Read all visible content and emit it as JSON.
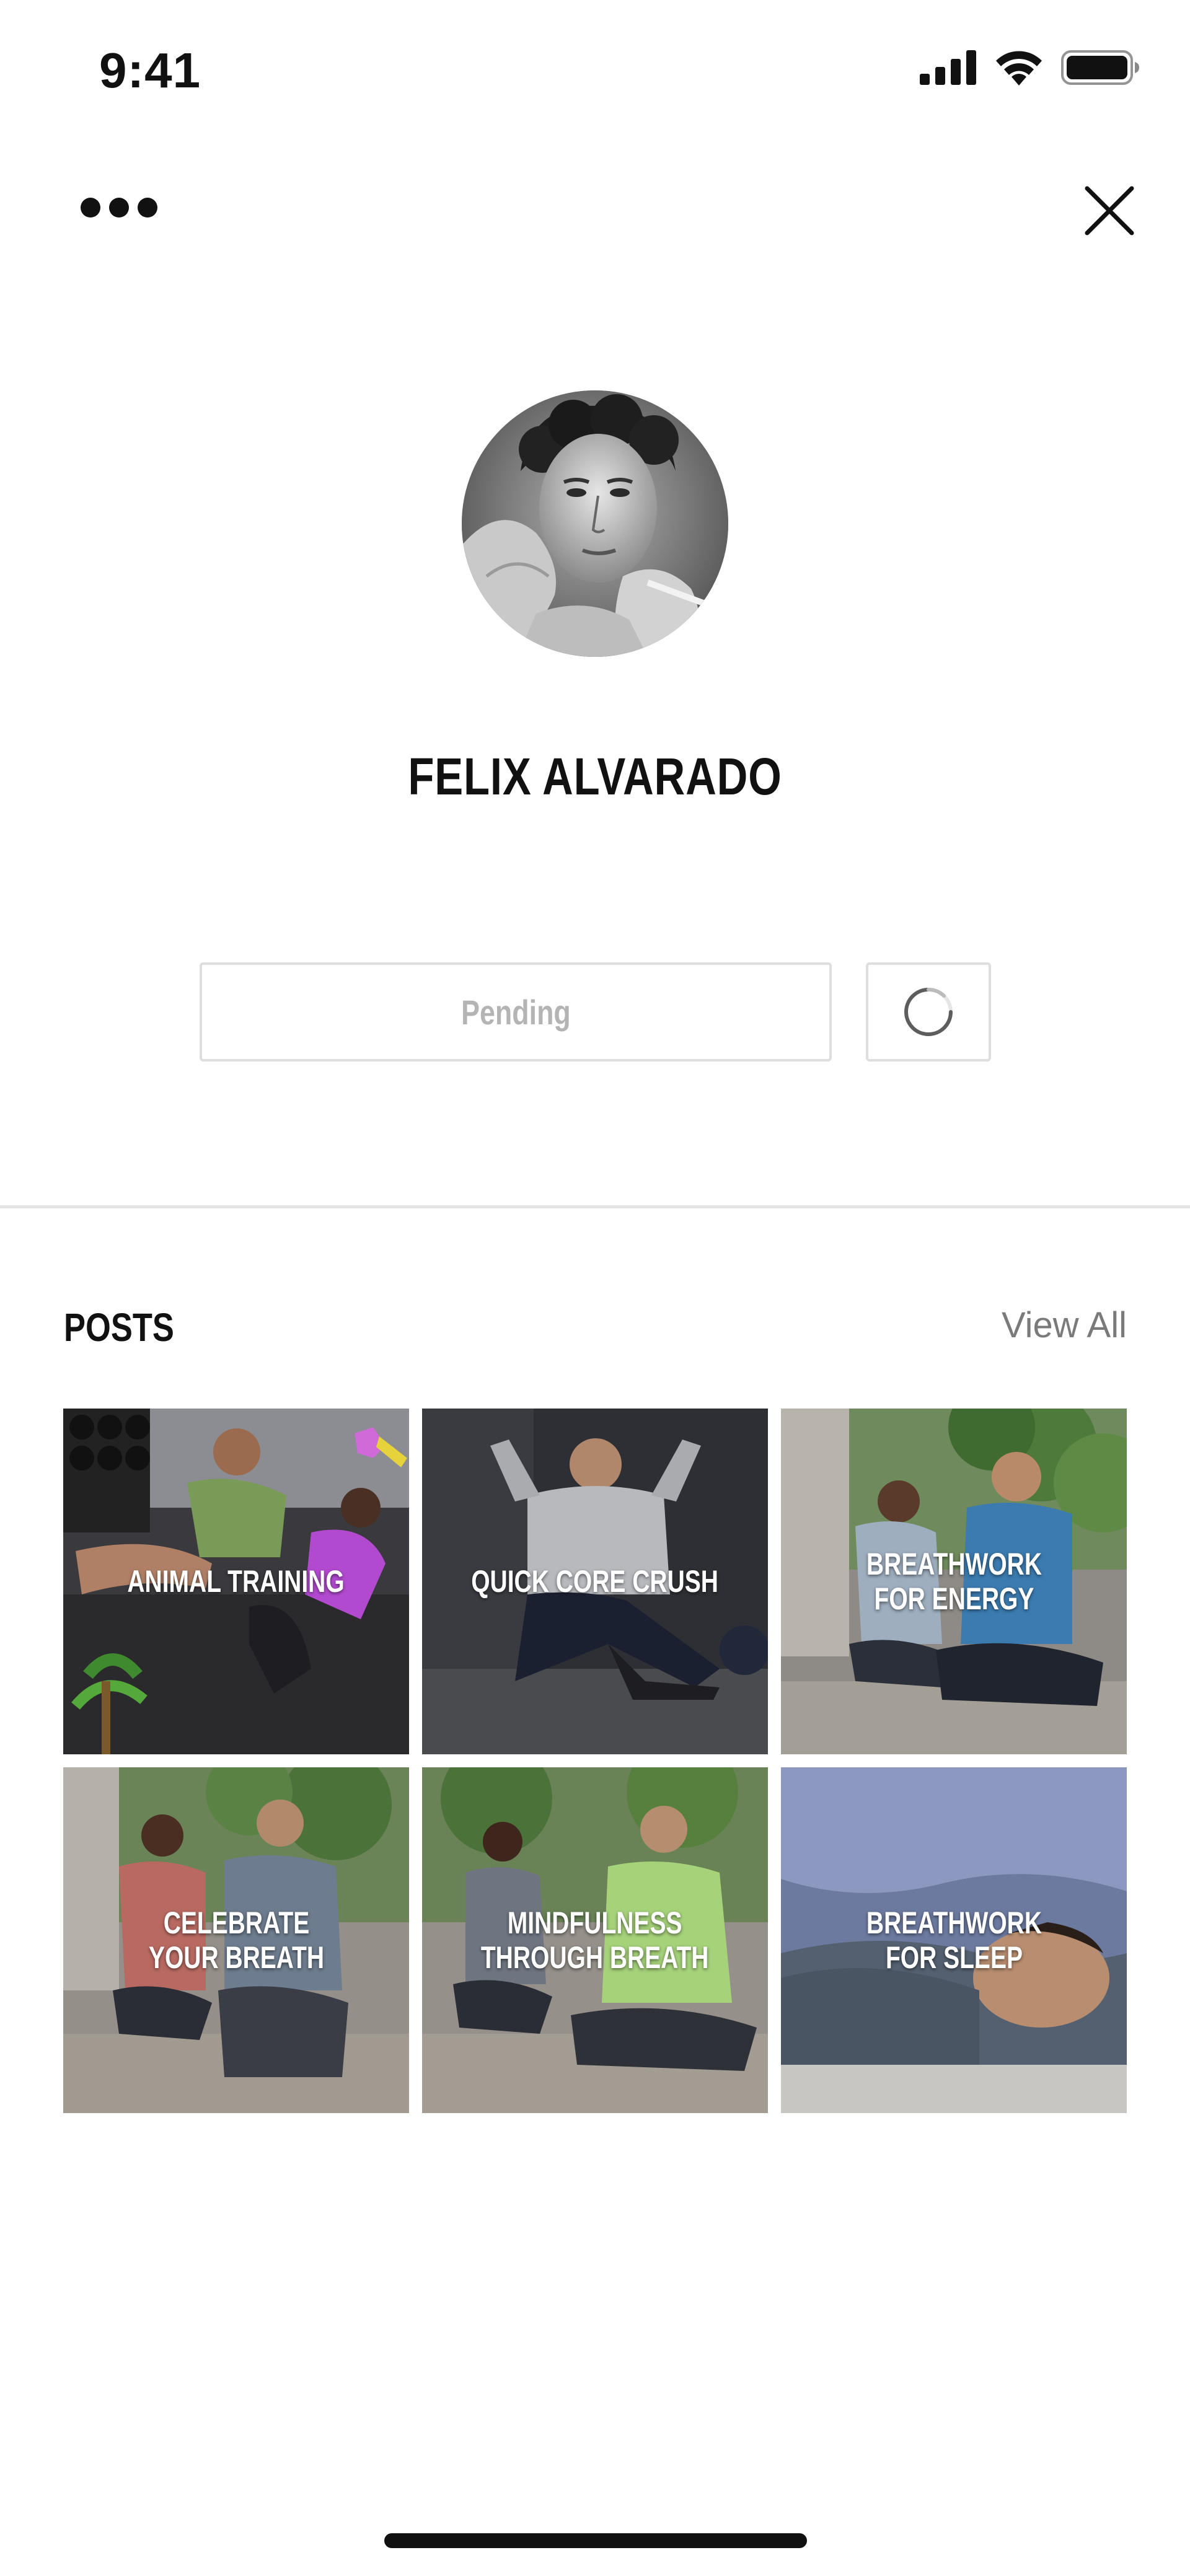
{
  "status_bar": {
    "time": "9:41",
    "icons": [
      "cellular-signal-icon",
      "wifi-icon",
      "battery-icon"
    ]
  },
  "nav": {
    "more_icon": "more-horizontal-icon",
    "close_icon": "close-icon"
  },
  "profile": {
    "name": "FELIX ALVARADO",
    "avatar": "profile-photo"
  },
  "actions": {
    "pending_label": "Pending",
    "loading_icon": "spinner-icon"
  },
  "posts": {
    "title": "POSTS",
    "view_all": "View All",
    "items": [
      {
        "label": "ANIMAL TRAINING",
        "theme": "dark-gym"
      },
      {
        "label": "QUICK CORE CRUSH",
        "theme": "dark-studio"
      },
      {
        "label": "BREATHWORK\nFOR ENERGY",
        "theme": "green-patio"
      },
      {
        "label": "CELEBRATE\nYOUR BREATH",
        "theme": "green-patio"
      },
      {
        "label": "MINDFULNESS\nTHROUGH BREATH",
        "theme": "green-patio"
      },
      {
        "label": "BREATHWORK\nFOR SLEEP",
        "theme": "blue-bedroom"
      }
    ]
  },
  "colors": {
    "text": "#111111",
    "muted": "#7a7a7a",
    "disabled": "#b4b4b4",
    "border": "#dedede"
  }
}
